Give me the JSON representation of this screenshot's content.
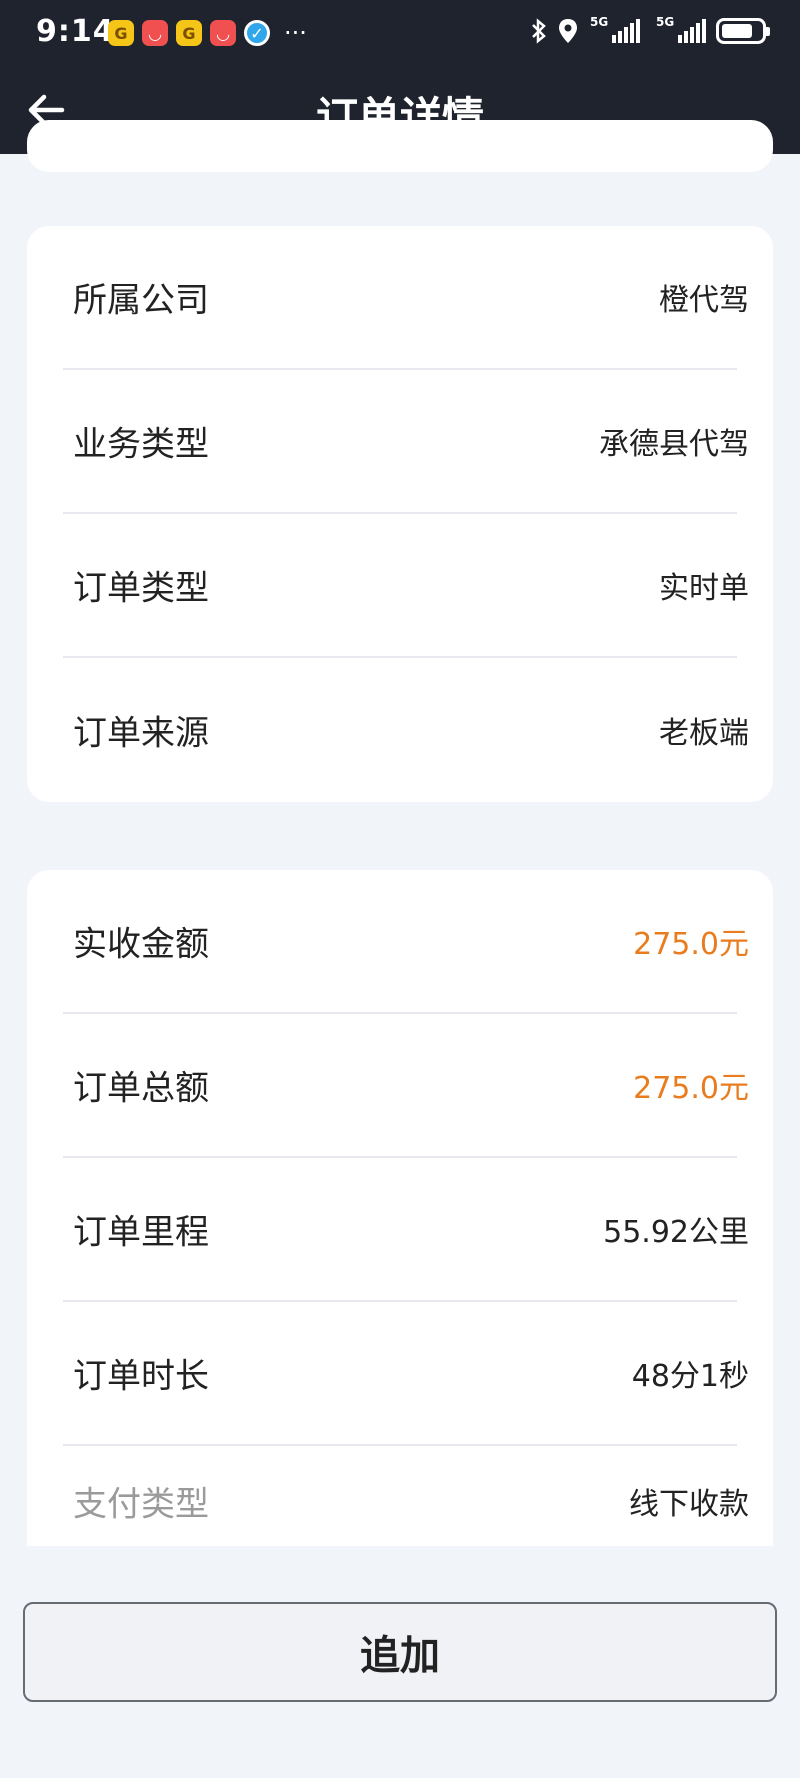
{
  "status_bar": {
    "time": "9:14",
    "net_label_1": "5G",
    "net_label_2": "5G"
  },
  "nav": {
    "title": "订单详情"
  },
  "company_card": [
    {
      "label": "所属公司",
      "value": "橙代驾"
    },
    {
      "label": "业务类型",
      "value": "承德县代驾"
    },
    {
      "label": "订单类型",
      "value": "实时单"
    },
    {
      "label": "订单来源",
      "value": "老板端"
    }
  ],
  "amount_card": [
    {
      "label": "实收金额",
      "value": "275.0元"
    },
    {
      "label": "订单总额",
      "value": "275.0元"
    },
    {
      "label": "订单里程",
      "value": "55.92公里"
    },
    {
      "label": "订单时长",
      "value": "48分1秒"
    },
    {
      "label": "支付类型",
      "value": "线下收款"
    }
  ],
  "add_button": {
    "label": "追加"
  },
  "colors": {
    "header": "#1e232d",
    "accent": "#e87c1e",
    "background": "#f1f4f8"
  }
}
